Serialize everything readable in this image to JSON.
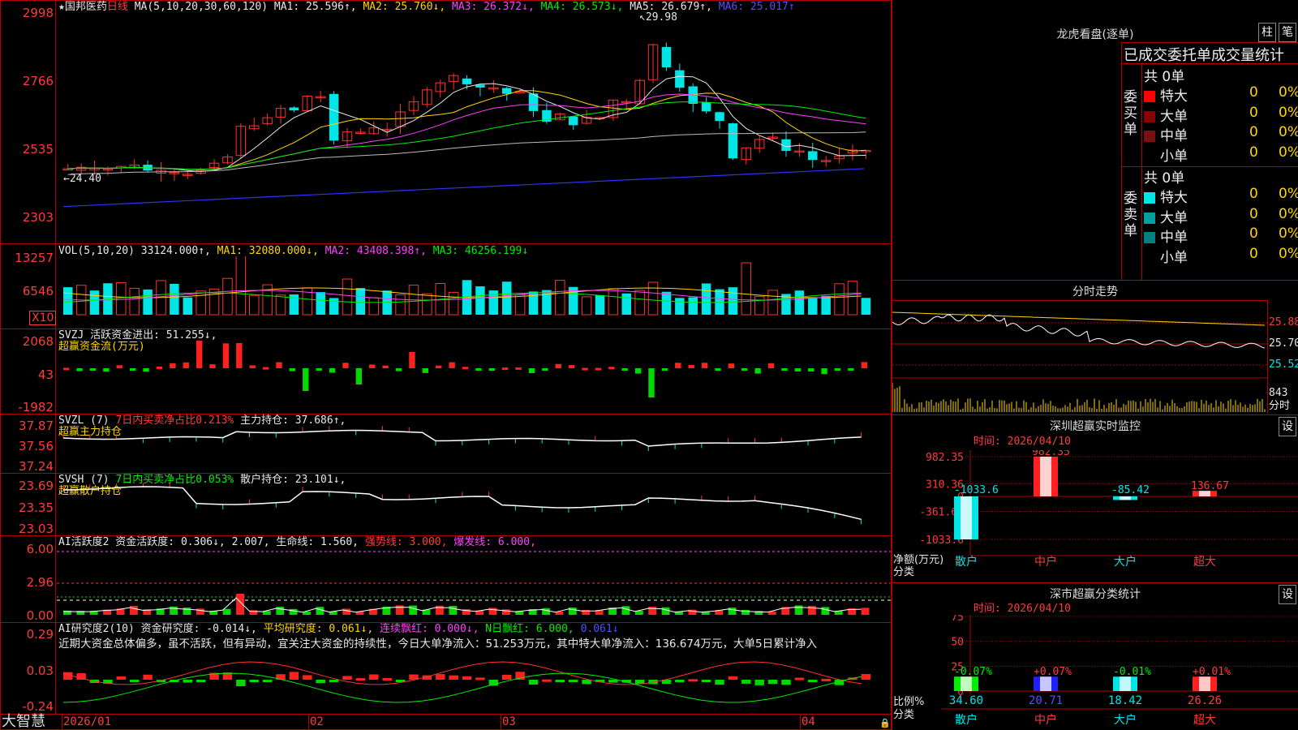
{
  "stock": {
    "star": "★",
    "name": "国邦医药",
    "period": "日线"
  },
  "ma_line": [
    {
      "text": "MA(5,10,20,30,60,120)",
      "color": "#e8e8e8"
    },
    {
      "text": "MA1: 25.596↑,",
      "color": "#e8e8e8"
    },
    {
      "text": "MA2: 25.760↓,",
      "color": "#ffd700"
    },
    {
      "text": "MA3: 26.372↓,",
      "color": "#ff40ff"
    },
    {
      "text": "MA4: 26.573↓,",
      "color": "#00ee00"
    },
    {
      "text": "MA5: 26.679↑,",
      "color": "#e8e8e8"
    },
    {
      "text": "MA6: 25.017↑",
      "color": "#5050ff"
    }
  ],
  "price_axis": [
    "2998",
    "2766",
    "2535",
    "2303"
  ],
  "price_annotations": {
    "high": "29.98",
    "low": "24.40"
  },
  "vol": {
    "legend": [
      {
        "text": "VOL(5,10,20)",
        "color": "#e8e8e8"
      },
      {
        "text": "33124.000↑,",
        "color": "#e8e8e8"
      },
      {
        "text": "MA1: 32080.000↓,",
        "color": "#ffd700"
      },
      {
        "text": "MA2: 43408.398↑,",
        "color": "#ff40ff"
      },
      {
        "text": "MA3: 46256.199↓",
        "color": "#00ee00"
      }
    ],
    "axis": [
      "13257",
      "6546"
    ],
    "unit": "X10"
  },
  "svzj": {
    "legend": [
      {
        "text": "SVZJ  活跃资金进出: 51.255↓,",
        "color": "#e8e8e8"
      }
    ],
    "sub": "超赢资金流(万元)",
    "axis": [
      "2068",
      "43",
      "-1982"
    ]
  },
  "svzl": {
    "legend": [
      {
        "text": "SVZL (7) ",
        "color": "#e8e8e8"
      },
      {
        "text": "7日内买卖净占比0.213%",
        "color": "#ff3b3b"
      },
      {
        "text": " 主力持仓: 37.686↑,",
        "color": "#e8e8e8"
      }
    ],
    "sub": "超赢主力持仓",
    "axis": [
      "37.87",
      "37.56",
      "37.24"
    ]
  },
  "svsh": {
    "legend": [
      {
        "text": "SVSH (7) ",
        "color": "#e8e8e8"
      },
      {
        "text": "7日内买卖净占比0.053%",
        "color": "#00ee00"
      },
      {
        "text": " 散户持仓: 23.101↓,",
        "color": "#e8e8e8"
      }
    ],
    "sub": "超赢散户持仓",
    "axis": [
      "23.69",
      "23.35",
      "23.03"
    ]
  },
  "ai_active": {
    "legend": [
      {
        "text": "AI活跃度2 资金活跃度: 0.306↓,",
        "color": "#e8e8e8"
      },
      {
        "text": "2.007,",
        "color": "#e8e8e8"
      },
      {
        "text": " 生命线: 1.560,",
        "color": "#e8e8e8"
      },
      {
        "text": " 强势线: 3.000,",
        "color": "#ff3b3b"
      },
      {
        "text": " 爆发线: 6.000,",
        "color": "#ff40ff"
      }
    ],
    "axis": [
      "6.00",
      "2.96",
      "0.00"
    ]
  },
  "ai_research": {
    "legend": [
      {
        "text": "AI研究度2(10) 资金研究度: -0.014↓,",
        "color": "#e8e8e8"
      },
      {
        "text": " 平均研究度: 0.061↓,",
        "color": "#ffd700"
      },
      {
        "text": " 连续飘红: 0.000↓,",
        "color": "#ff40ff"
      },
      {
        "text": " N日飘红: 6.000,",
        "color": "#00ee00"
      },
      {
        "text": " 0.061↓",
        "color": "#5050ff"
      }
    ],
    "comment": "近期大资金总体偏多，虽不活跃，但有异动，宜关注大资金的持续性，今日大单净流入：51.253万元，其中特大单净流入：136.674万元，大单5日累计净入",
    "axis": [
      "0.29",
      "0.03",
      "-0.24"
    ]
  },
  "date_axis": [
    "2026/01",
    "02",
    "03",
    "04"
  ],
  "brand": "大智慧",
  "longhu": {
    "title": "龙虎看盘(逐单)",
    "btn1": "柱",
    "btn2": "笔",
    "tabs": "已成交委托单成交量统计",
    "buy_side": "委买单",
    "sell_side": "委卖单",
    "buy_total": "共 0单",
    "sell_total": "共 0单",
    "buy_rows": [
      {
        "label": "特大",
        "count": "0",
        "pct": "0%",
        "color": "#ff0000"
      },
      {
        "label": "大单",
        "count": "0",
        "pct": "0%",
        "color": "#8b0000"
      },
      {
        "label": "中单",
        "count": "0",
        "pct": "0%",
        "color": "#7a1010"
      },
      {
        "label": "小单",
        "count": "0",
        "pct": "0%",
        "color": "#000000"
      }
    ],
    "sell_rows": [
      {
        "label": "特大",
        "count": "0",
        "pct": "0%",
        "color": "#00e5e5"
      },
      {
        "label": "大单",
        "count": "0",
        "pct": "0%",
        "color": "#00a0a0"
      },
      {
        "label": "中单",
        "count": "0",
        "pct": "0%",
        "color": "#008080"
      },
      {
        "label": "小单",
        "count": "0",
        "pct": "0%",
        "color": "#000000"
      }
    ]
  },
  "intraday": {
    "title": "分时走势",
    "axis": [
      "25.88",
      "25.70",
      "25.52"
    ],
    "vol": "843",
    "unit": "分时"
  },
  "sz_monitor": {
    "title": "深圳超赢实时监控",
    "btn": "设",
    "time": "时间: 2026/04/10",
    "axis": [
      "982.35",
      "310.36",
      "0",
      "-361.62",
      "-1033.6"
    ],
    "ylabel": "净额(万元)",
    "xlabel": "分类",
    "chart_data": {
      "type": "bar",
      "categories": [
        "散户",
        "中户",
        "大户",
        "超大"
      ],
      "values": [
        -1033.6,
        982.35,
        -85.42,
        136.67
      ],
      "labels": [
        "-1033.6",
        "982.35",
        "-85.42",
        "136.67"
      ]
    }
  },
  "sz_class": {
    "title": "深市超赢分类统计",
    "btn": "设",
    "time": "时间: 2026/04/10",
    "axis": [
      "75",
      "50",
      "25",
      "0"
    ],
    "ylabel": "比例%",
    "xlabel": "分类",
    "chart_data": {
      "type": "bar",
      "categories": [
        "散户",
        "中户",
        "大户",
        "超大"
      ],
      "values": [
        34.6,
        20.71,
        18.42,
        26.26
      ],
      "changes": [
        "-0.07%",
        "+0.07%",
        "-0.01%",
        "+0.01%"
      ],
      "value_labels": [
        "34.60",
        "20.71",
        "18.42",
        "26.26"
      ]
    }
  }
}
